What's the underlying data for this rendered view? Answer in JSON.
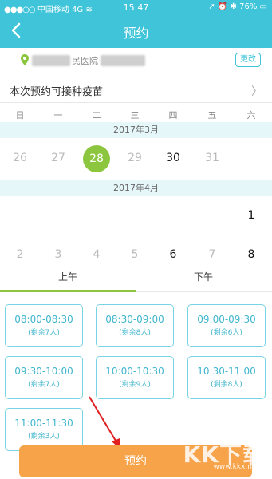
{
  "status_bar": {
    "carrier": "中国移动",
    "network": "4G",
    "time": "15:47",
    "battery": "76%"
  },
  "header": {
    "title": "预约"
  },
  "location": {
    "hospital_fragment": "民医院",
    "change_label": "更改"
  },
  "vaccine_row": {
    "label": "本次预约可接种疫苗"
  },
  "calendar": {
    "weekdays": [
      "日",
      "一",
      "二",
      "三",
      "四",
      "五",
      "六"
    ],
    "months": [
      {
        "label": "2017年3月",
        "days": [
          {
            "day": "26",
            "col": 0,
            "state": "past"
          },
          {
            "day": "27",
            "col": 1,
            "state": "past"
          },
          {
            "day": "28",
            "col": 2,
            "state": "selected"
          },
          {
            "day": "29",
            "col": 3,
            "state": "past"
          },
          {
            "day": "30",
            "col": 4,
            "state": "available"
          },
          {
            "day": "31",
            "col": 5,
            "state": "past"
          }
        ]
      },
      {
        "label": "2017年4月",
        "days": [
          {
            "day": "1",
            "col": 6,
            "state": "available"
          },
          {
            "day": "2",
            "col": 0,
            "state": "past"
          },
          {
            "day": "3",
            "col": 1,
            "state": "past"
          },
          {
            "day": "4",
            "col": 2,
            "state": "past"
          },
          {
            "day": "5",
            "col": 3,
            "state": "past"
          },
          {
            "day": "6",
            "col": 4,
            "state": "available"
          },
          {
            "day": "7",
            "col": 5,
            "state": "past"
          },
          {
            "day": "8",
            "col": 6,
            "state": "available"
          }
        ]
      }
    ]
  },
  "tabs": {
    "morning": "上午",
    "afternoon": "下午",
    "active": "morning"
  },
  "slots": [
    {
      "time": "08:00-08:30",
      "remaining": "(剩余7人)"
    },
    {
      "time": "08:30-09:00",
      "remaining": "(剩余8人)"
    },
    {
      "time": "09:00-09:30",
      "remaining": "(剩余6人)"
    },
    {
      "time": "09:30-10:00",
      "remaining": "(剩余7人)"
    },
    {
      "time": "10:00-10:30",
      "remaining": "(剩余9人)"
    },
    {
      "time": "10:30-11:00",
      "remaining": "(剩余8人)"
    },
    {
      "time": "11:00-11:30",
      "remaining": "(剩余3人)"
    }
  ],
  "book_button": {
    "label": "预约"
  },
  "watermark": {
    "brand": "KK下载",
    "url": "www.kkx.net"
  },
  "colors": {
    "header": "#3fc4d9",
    "selected_day": "#8cc63f",
    "slot_border": "#78d4e4",
    "book_button": "#f7a349"
  }
}
